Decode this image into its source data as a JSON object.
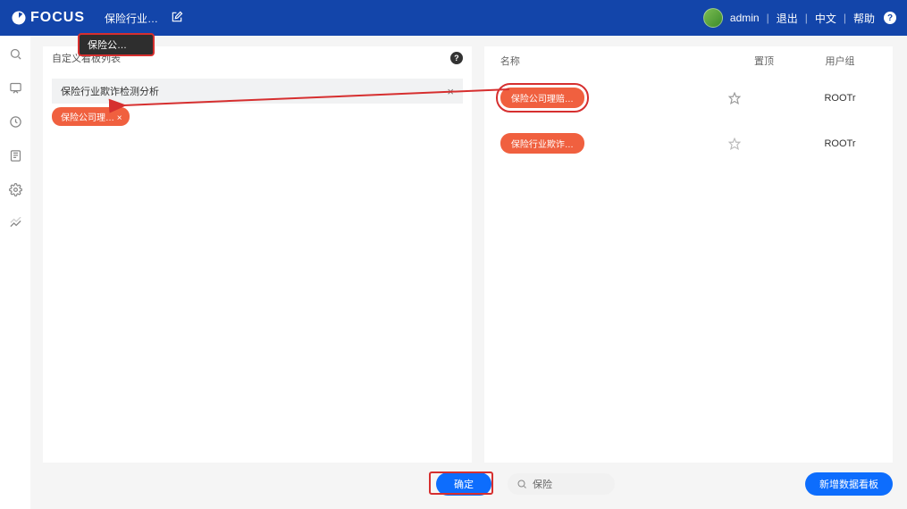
{
  "colors": {
    "primary": "#1345aa",
    "accent": "#0d6dfd",
    "danger": "#d62f2f",
    "chip": "#f0603f"
  },
  "header": {
    "logo_text": "FOCUS",
    "breadcrumb": "保险行业…",
    "user": "admin",
    "logout": "退出",
    "lang": "中文",
    "help": "帮助"
  },
  "float_tab": "保险公…",
  "left_panel": {
    "title": "自定义看板列表",
    "search_value": "保险行业欺诈检测分析",
    "chip_label": "保险公司理… ×"
  },
  "right_panel": {
    "columns": {
      "name": "名称",
      "pin": "置顶",
      "user": "用户组"
    },
    "rows": [
      {
        "name": "保险公司理赔…",
        "user": "ROOTr",
        "starred_filled": true
      },
      {
        "name": "保险行业欺诈…",
        "user": "ROOTr",
        "starred_filled": false
      }
    ]
  },
  "bottom": {
    "confirm": "确定",
    "search_placeholder": "保险",
    "add": "新增数据看板"
  }
}
